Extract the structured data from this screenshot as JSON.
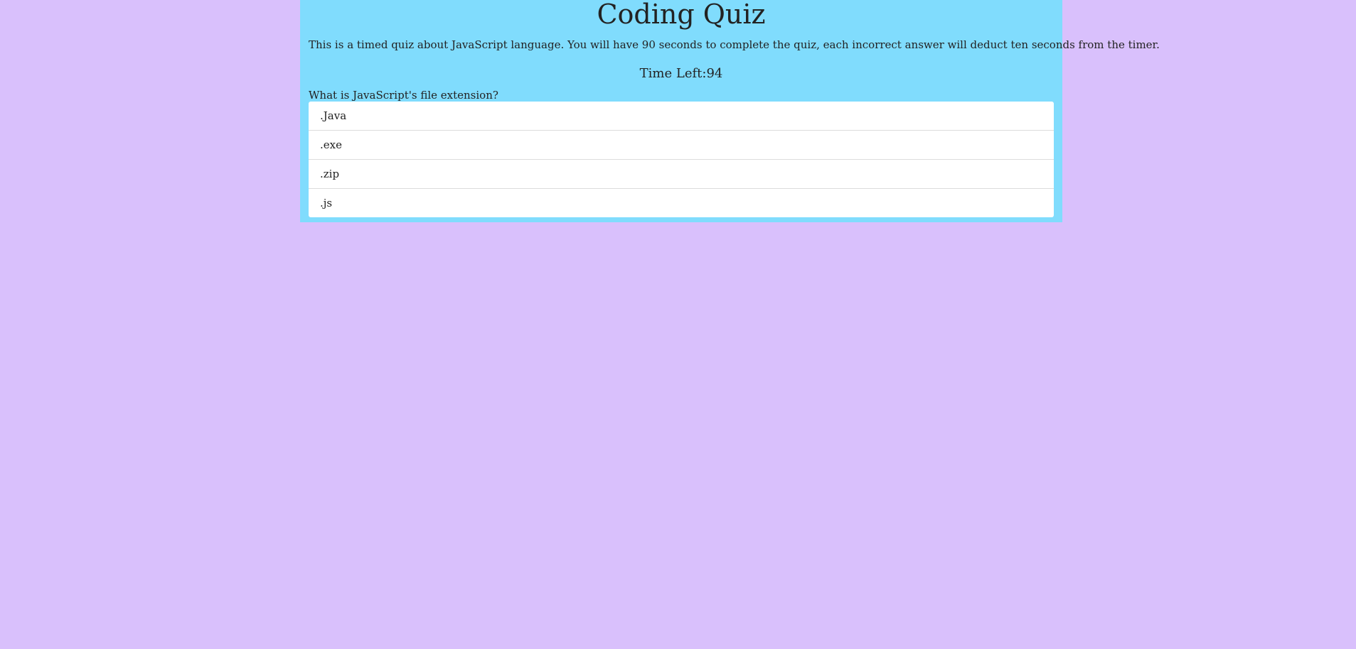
{
  "quiz": {
    "title": "Coding Quiz",
    "description": "This is a timed quiz about JavaScript language. You will have 90 seconds to complete the quiz, each incorrect answer will deduct ten seconds from the timer.",
    "timer_label": "Time Left:",
    "time_left": "94",
    "question": "What is JavaScript's file extension?",
    "answers": [
      ".Java",
      ".exe",
      ".zip",
      ".js"
    ]
  },
  "colors": {
    "page_background": "#d9c0fc",
    "panel_background": "#80dcfd",
    "answer_background": "#ffffff"
  }
}
